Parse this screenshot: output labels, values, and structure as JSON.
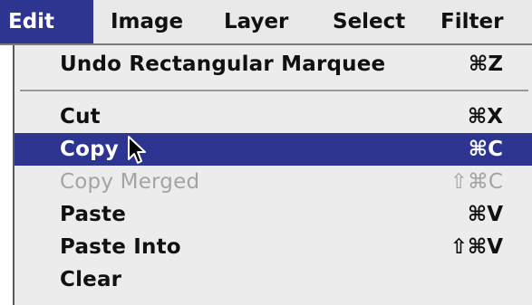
{
  "menubar": {
    "menus": [
      {
        "label": "Edit"
      },
      {
        "label": "Image"
      },
      {
        "label": "Layer"
      },
      {
        "label": "Select"
      },
      {
        "label": "Filter"
      }
    ]
  },
  "edit_menu": {
    "items": [
      {
        "label": "Undo Rectangular Marquee",
        "shortcut": "⌘Z",
        "state": "normal"
      },
      {
        "label": "Cut",
        "shortcut": "⌘X",
        "state": "normal"
      },
      {
        "label": "Copy",
        "shortcut": "⌘C",
        "state": "highlighted"
      },
      {
        "label": "Copy Merged",
        "shortcut": "⇧⌘C",
        "state": "disabled"
      },
      {
        "label": "Paste",
        "shortcut": "⌘V",
        "state": "normal"
      },
      {
        "label": "Paste Into",
        "shortcut": "⇧⌘V",
        "state": "normal"
      },
      {
        "label": "Clear",
        "shortcut": "",
        "state": "normal"
      }
    ]
  },
  "colors": {
    "highlight": "#2d3590",
    "menu_background": "#ececec",
    "disabled_text": "#a4a4a4"
  },
  "icons": {
    "pointer": "arrow-cursor-icon"
  }
}
